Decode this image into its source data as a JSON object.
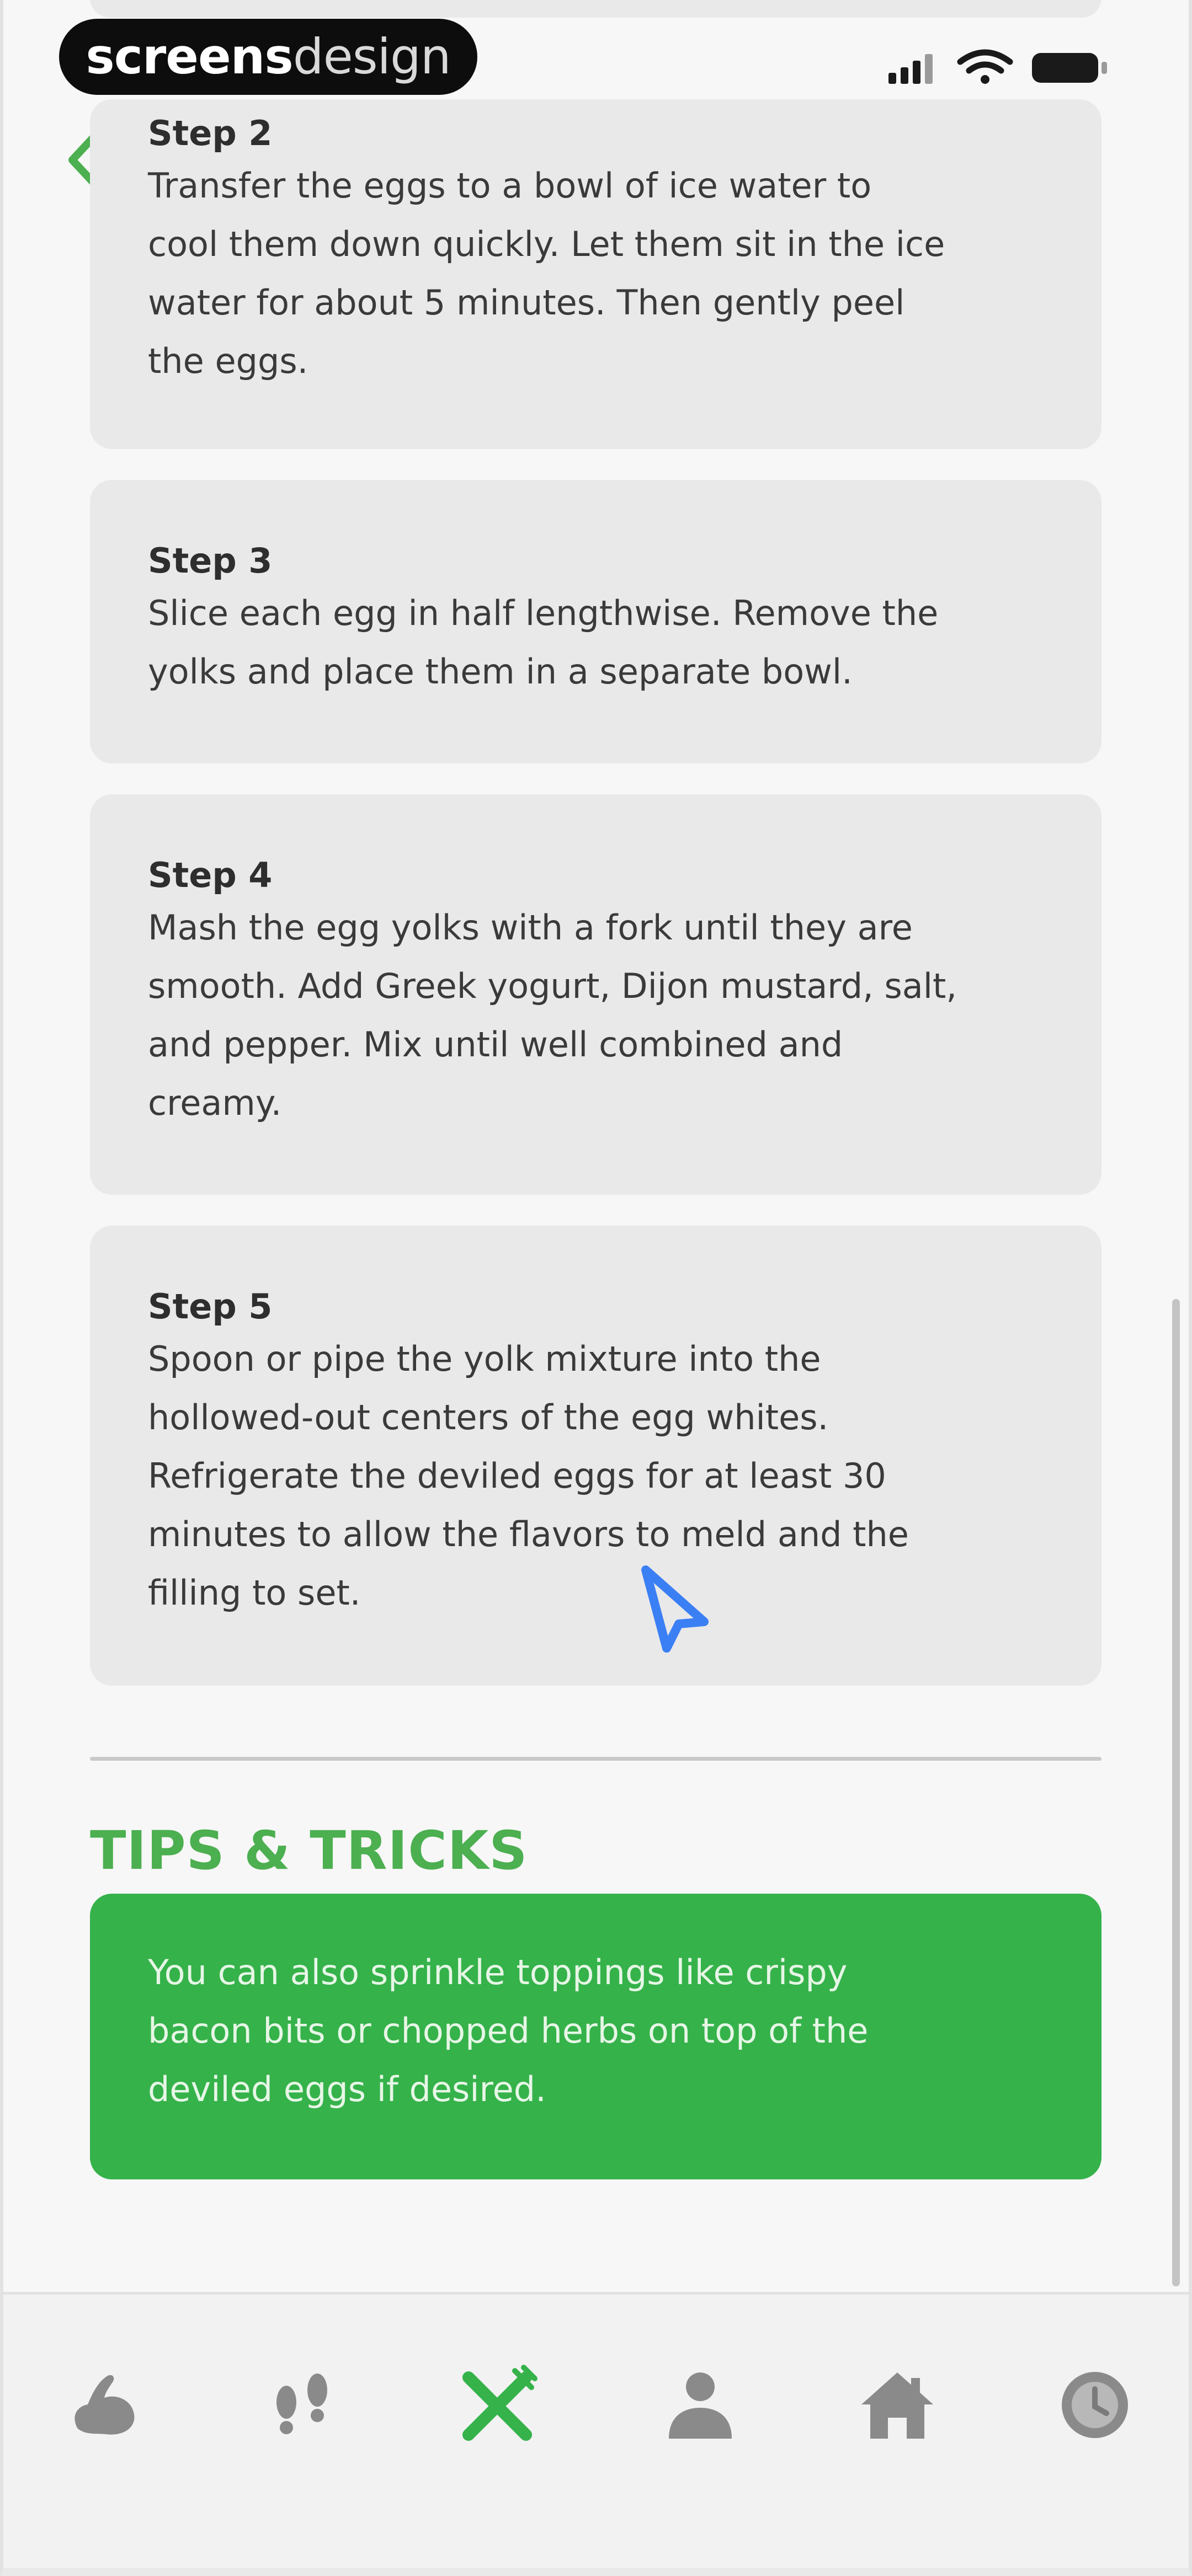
{
  "brand": {
    "bold": "screens",
    "light": "design"
  },
  "colors": {
    "accent": "#35b24a",
    "accent_text": "#4caf50",
    "card": "#e9e9e9",
    "icon_gray": "#8a8a8a"
  },
  "navigation": {
    "back_icon": "chevron-left-icon"
  },
  "steps": [
    {
      "title": "Step 2",
      "lines": [
        "Transfer the eggs to a bowl of ice water to",
        "cool them down quickly. Let them sit in the ice",
        "water for about 5 minutes. Then gently peel",
        "the eggs."
      ]
    },
    {
      "title": "Step 3",
      "lines": [
        "Slice each egg in half lengthwise. Remove the",
        "yolks and place them in a separate bowl."
      ]
    },
    {
      "title": "Step 4",
      "lines": [
        "Mash the egg yolks with a fork until they are",
        "smooth. Add Greek yogurt, Dijon mustard, salt,",
        "and pepper. Mix until well combined and",
        "creamy."
      ]
    },
    {
      "title": "Step 5",
      "lines": [
        "Spoon or pipe the yolk mixture into the",
        "hollowed-out centers of the egg whites.",
        "Refrigerate the deviled eggs for at least 30",
        "minutes to allow the flavors to meld and the",
        "filling to set."
      ]
    }
  ],
  "tips": {
    "heading": "TIPS & TRICKS",
    "lines": [
      "You can also sprinkle toppings like crispy",
      "bacon bits or chopped herbs on top of the",
      "deviled eggs if desired."
    ]
  },
  "bottom_nav": [
    {
      "icon": "muscle-arm-icon",
      "active": false
    },
    {
      "icon": "footprints-icon",
      "active": false
    },
    {
      "icon": "fork-knife-icon",
      "active": true
    },
    {
      "icon": "person-icon",
      "active": false
    },
    {
      "icon": "home-icon",
      "active": false
    },
    {
      "icon": "clock-icon",
      "active": false
    }
  ]
}
